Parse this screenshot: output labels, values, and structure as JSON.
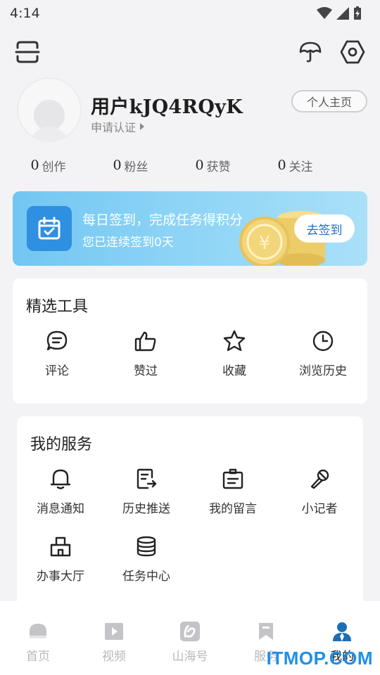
{
  "status_bar": {
    "time": "4:14"
  },
  "profile": {
    "username": "用户kJQ4RQyK",
    "apply_label": "申请认证",
    "homepage_label": "个人主页"
  },
  "stats": [
    {
      "num": "0",
      "label": "创作"
    },
    {
      "num": "0",
      "label": "粉丝"
    },
    {
      "num": "0",
      "label": "获赞"
    },
    {
      "num": "0",
      "label": "关注"
    }
  ],
  "checkin": {
    "title": "每日签到，完成任务得积分",
    "subtitle": "您已连续签到0天",
    "button": "去签到"
  },
  "tools": {
    "title": "精选工具",
    "items": [
      {
        "label": "评论",
        "icon": "comment-icon"
      },
      {
        "label": "赞过",
        "icon": "thumbs-up-icon"
      },
      {
        "label": "收藏",
        "icon": "star-icon"
      },
      {
        "label": "浏览历史",
        "icon": "clock-icon"
      }
    ]
  },
  "services": {
    "title": "我的服务",
    "items": [
      {
        "label": "消息通知",
        "icon": "bell-icon"
      },
      {
        "label": "历史推送",
        "icon": "document-arrow-icon"
      },
      {
        "label": "我的留言",
        "icon": "clipboard-icon"
      },
      {
        "label": "小记者",
        "icon": "microphone-icon"
      },
      {
        "label": "办事大厅",
        "icon": "building-icon"
      },
      {
        "label": "任务中心",
        "icon": "database-icon"
      }
    ]
  },
  "tab_bar": [
    {
      "label": "首页",
      "icon": "home-icon"
    },
    {
      "label": "视频",
      "icon": "video-icon"
    },
    {
      "label": "山海号",
      "icon": "shanhai-logo-icon"
    },
    {
      "label": "服务",
      "icon": "bookmark-icon"
    },
    {
      "label": "我的",
      "icon": "person-icon",
      "active": true
    }
  ],
  "watermark": "ITMOP.COM",
  "colors": {
    "accent": "#1e90e6",
    "checkin_start": "#72c6f2",
    "checkin_end": "#a9e0f7",
    "page_bg": "#f3f3f5"
  }
}
